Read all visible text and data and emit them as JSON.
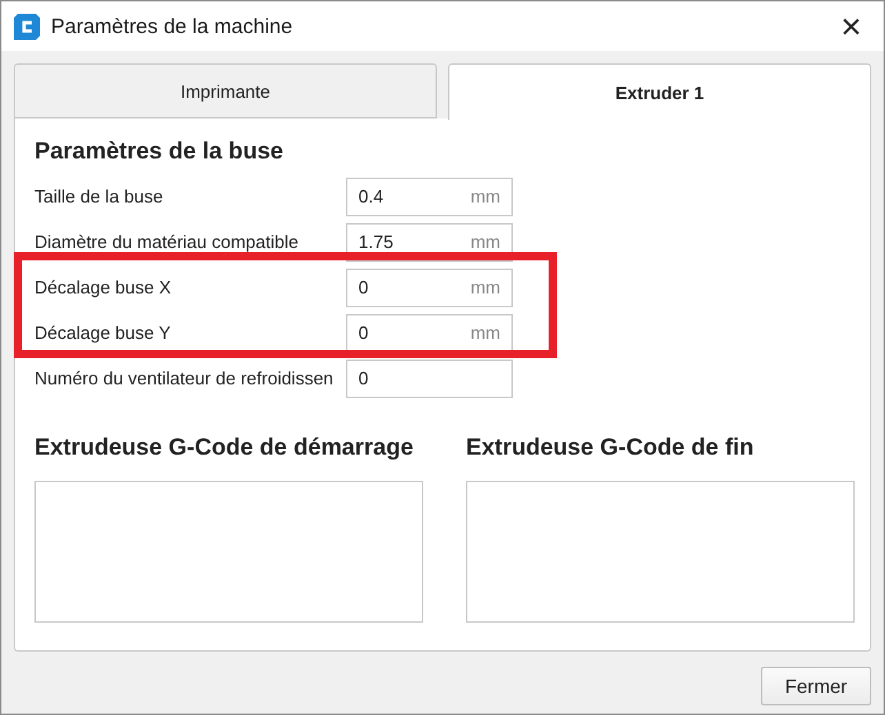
{
  "window": {
    "title": "Paramètres de la machine",
    "close": "×"
  },
  "tabs": [
    {
      "label": "Imprimante",
      "selected": false
    },
    {
      "label": "Extruder 1",
      "selected": true
    }
  ],
  "section_title": "Paramètres de la buse",
  "fields": [
    {
      "label": "Taille de la buse",
      "value": "0.4",
      "unit": "mm",
      "highlighted": false
    },
    {
      "label": "Diamètre du matériau compatible",
      "value": "1.75",
      "unit": "mm",
      "highlighted": false
    },
    {
      "label": "Décalage buse X",
      "value": "0",
      "unit": "mm",
      "highlighted": true
    },
    {
      "label": "Décalage buse Y",
      "value": "0",
      "unit": "mm",
      "highlighted": true
    },
    {
      "label": "Numéro du ventilateur de refroidissen",
      "value": "0",
      "highlighted": false
    }
  ],
  "gcode": [
    {
      "title": "Extrudeuse G-Code de démarrage"
    },
    {
      "title": "Extrudeuse G-Code de fin"
    }
  ],
  "buttons": [
    "Fermer"
  ]
}
